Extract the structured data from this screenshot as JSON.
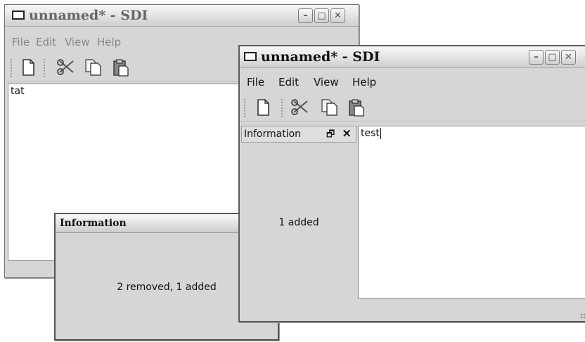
{
  "background_window": {
    "title": "unnamed* - SDI",
    "menu": [
      "File",
      "Edit",
      "View",
      "Help"
    ],
    "text_content": "tat"
  },
  "info_dialog": {
    "title": "Information",
    "message": "2 removed, 1 added"
  },
  "front_window": {
    "title": "unnamed* - SDI",
    "menu": [
      "File",
      "Edit",
      "View",
      "Help"
    ],
    "dock": {
      "title": "Information",
      "float_glyph": "🗗",
      "close_glyph": "×",
      "message": "1 added"
    },
    "text_content": "test"
  },
  "titlebar_buttons": {
    "minimize": "–",
    "maximize": "□",
    "close": "✕"
  },
  "toolbar_icons": [
    "new-file-icon",
    "cut-icon",
    "copy-icon",
    "paste-icon"
  ]
}
